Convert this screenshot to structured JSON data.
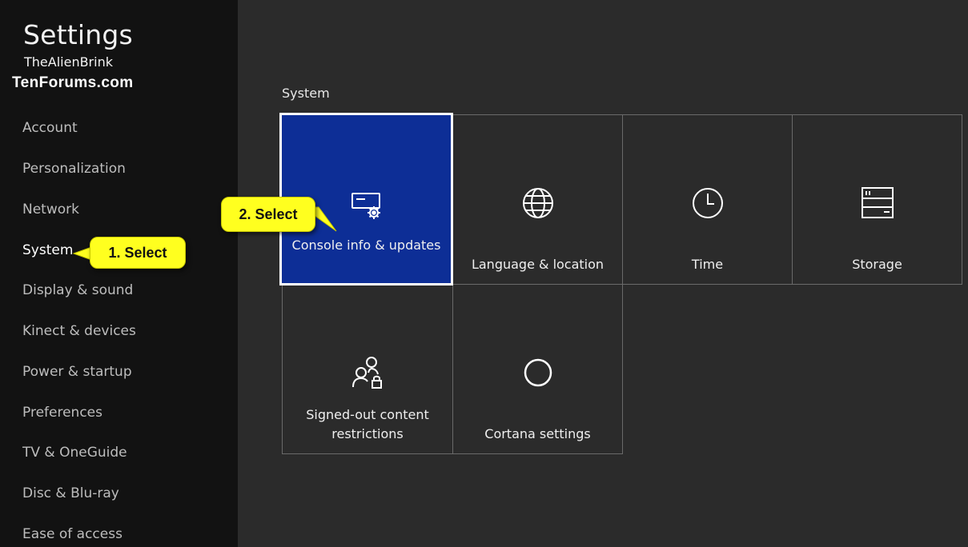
{
  "sidebar": {
    "title": "Settings",
    "user": "TheAlienBrink",
    "watermark": "TenForums.com",
    "items": [
      {
        "label": "Account"
      },
      {
        "label": "Personalization"
      },
      {
        "label": "Network"
      },
      {
        "label": "System"
      },
      {
        "label": "Display & sound"
      },
      {
        "label": "Kinect & devices"
      },
      {
        "label": "Power & startup"
      },
      {
        "label": "Preferences"
      },
      {
        "label": "TV & OneGuide"
      },
      {
        "label": "Disc & Blu-ray"
      },
      {
        "label": "Ease of access"
      }
    ],
    "selected": "System"
  },
  "callouts": {
    "step1": "1. Select",
    "step2": "2. Select"
  },
  "main": {
    "section_title": "System",
    "tiles": [
      {
        "label": "Console info & updates",
        "icon": "console-settings-icon",
        "selected": true
      },
      {
        "label": "Language & location",
        "icon": "globe-icon"
      },
      {
        "label": "Time",
        "icon": "clock-icon"
      },
      {
        "label": "Storage",
        "icon": "storage-icon"
      },
      {
        "label": "Signed-out content restrictions",
        "icon": "users-lock-icon"
      },
      {
        "label": "Cortana settings",
        "icon": "cortana-icon"
      }
    ]
  },
  "colors": {
    "background": "#2b2b2b",
    "sidebar": "#121212",
    "selected_tile": "#0d2e96",
    "callout": "#ffff1f"
  }
}
